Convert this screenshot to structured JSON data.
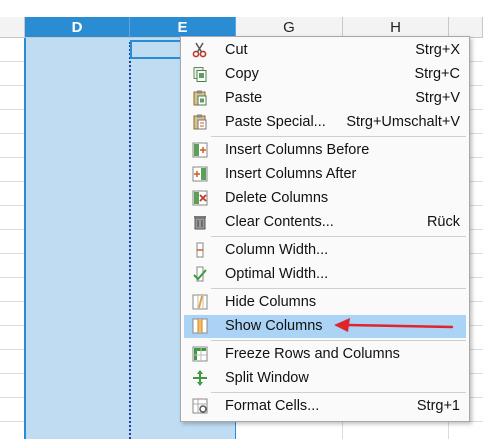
{
  "columns": {
    "D": "D",
    "E": "E",
    "G": "G",
    "H": "H"
  },
  "context_menu": {
    "items": [
      {
        "label": "Cut",
        "shortcut": "Strg+X",
        "icon": "scissors-icon"
      },
      {
        "label": "Copy",
        "shortcut": "Strg+C",
        "icon": "copy-icon"
      },
      {
        "label": "Paste",
        "shortcut": "Strg+V",
        "icon": "paste-icon"
      },
      {
        "label": "Paste Special...",
        "shortcut": "Strg+Umschalt+V",
        "icon": "paste-special-icon"
      },
      {
        "label": "Insert Columns Before",
        "shortcut": "",
        "icon": "insert-columns-before-icon"
      },
      {
        "label": "Insert Columns After",
        "shortcut": "",
        "icon": "insert-columns-after-icon"
      },
      {
        "label": "Delete Columns",
        "shortcut": "",
        "icon": "delete-columns-icon"
      },
      {
        "label": "Clear Contents...",
        "shortcut": "Rück",
        "icon": "trash-icon"
      },
      {
        "label": "Column Width...",
        "shortcut": "",
        "icon": "column-width-icon"
      },
      {
        "label": "Optimal Width...",
        "shortcut": "",
        "icon": "optimal-width-icon"
      },
      {
        "label": "Hide Columns",
        "shortcut": "",
        "icon": "hide-columns-icon"
      },
      {
        "label": "Show Columns",
        "shortcut": "",
        "icon": "show-columns-icon"
      },
      {
        "label": "Freeze Rows and Columns",
        "shortcut": "",
        "icon": "freeze-icon"
      },
      {
        "label": "Split Window",
        "shortcut": "",
        "icon": "split-window-icon"
      },
      {
        "label": "Format Cells...",
        "shortcut": "Strg+1",
        "icon": "format-cells-icon"
      }
    ],
    "highlighted_item": "Show Columns"
  },
  "colors": {
    "selection": "#bfdcf3",
    "header_selected": "#2a8dd4",
    "menu_highlight": "#abd3f6",
    "annotation_arrow": "#e0242b"
  }
}
